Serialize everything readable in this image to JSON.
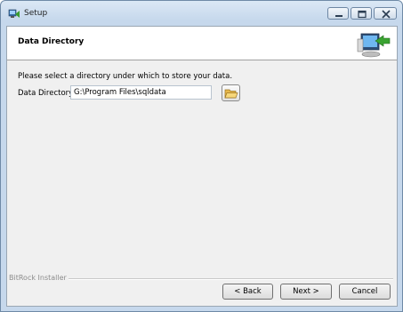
{
  "window": {
    "title": "Setup"
  },
  "header": {
    "title": "Data Directory"
  },
  "main": {
    "instruction": "Please select a directory under which to store your data.",
    "field_label": "Data Directory",
    "field_value": "G:\\Program Files\\sqldata"
  },
  "footer": {
    "installer": "BitRock Installer",
    "back_label": "< Back",
    "next_label": "Next >",
    "cancel_label": "Cancel"
  },
  "icons": {
    "app": "setup-app-icon",
    "header": "computer-install-icon",
    "browse": "folder-open-icon",
    "minimize": "minimize-icon",
    "maximize": "maximize-icon",
    "close": "close-icon"
  },
  "colors": {
    "titlebar": "#c6d8ec",
    "close_accent": "#c94a3a",
    "client_bg": "#f0f0f0"
  }
}
